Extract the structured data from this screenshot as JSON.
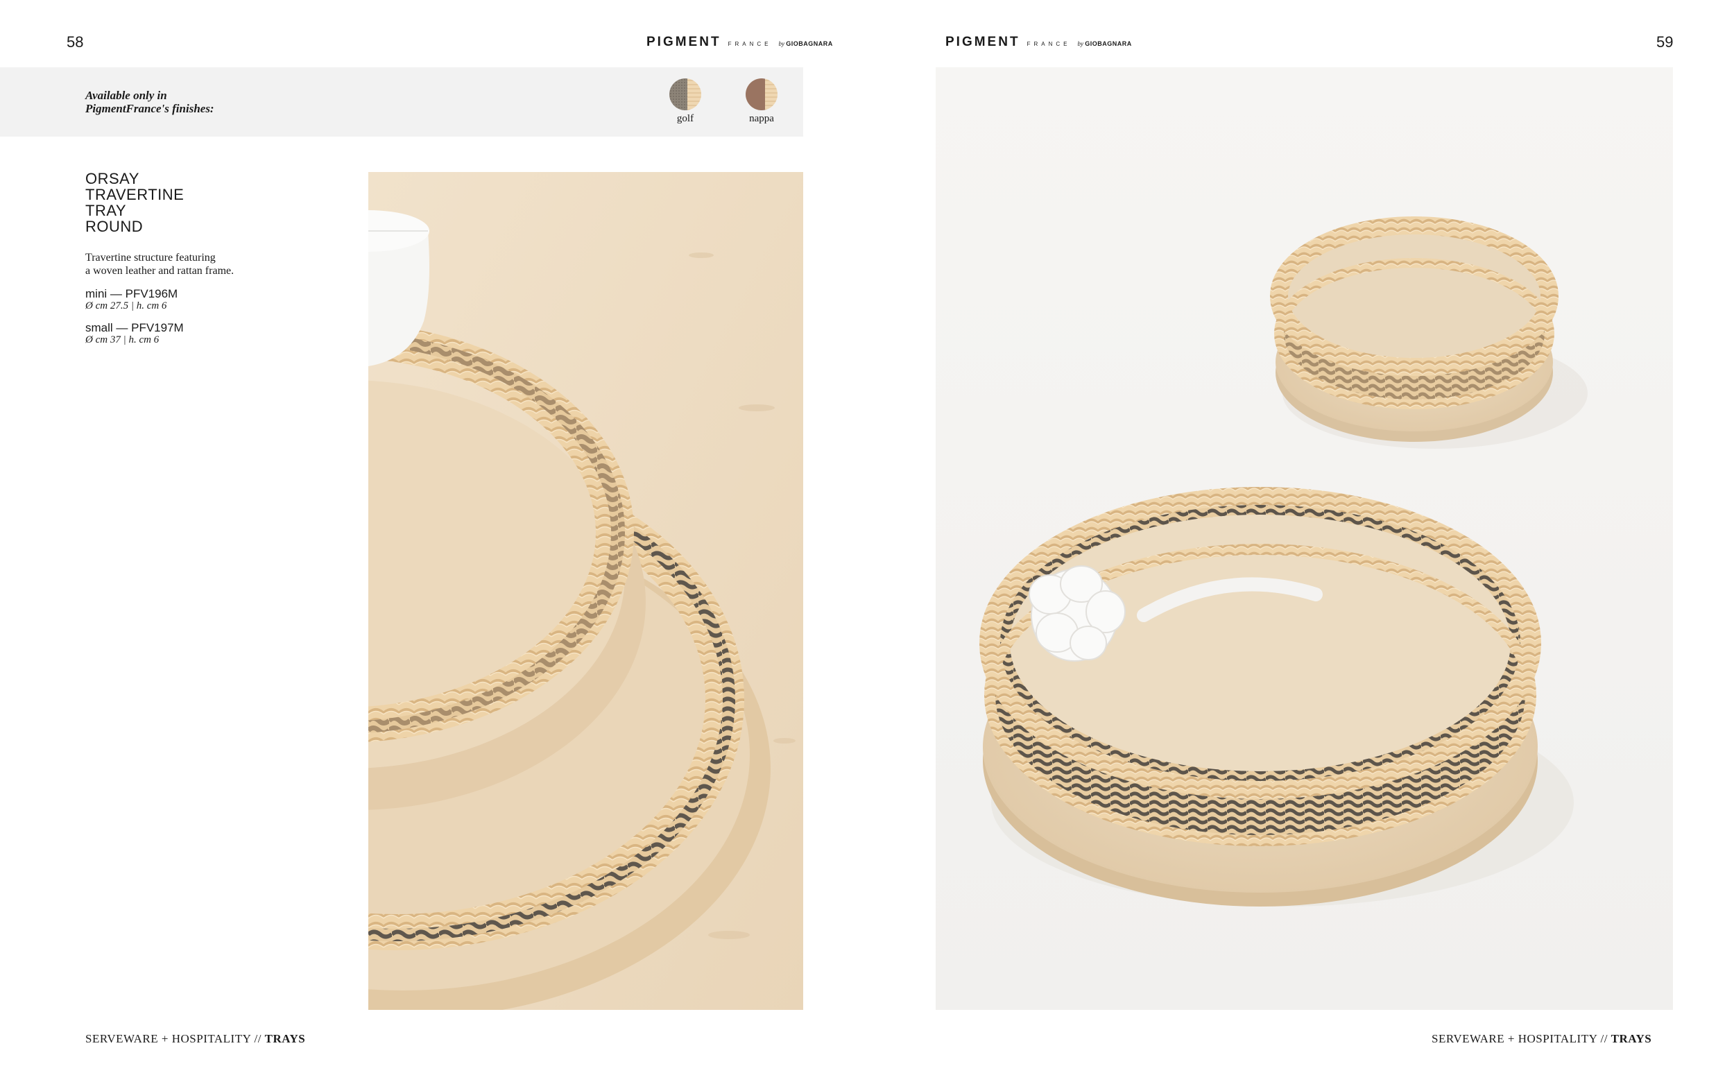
{
  "left_page": {
    "page_number": "58",
    "brand": {
      "main": "PIGMENT",
      "sub": "FRANCE",
      "by": "by",
      "maker": "GIOBAGNARA"
    },
    "finishes": {
      "label_line1": "Available only in",
      "label_line2": "PigmentFrance's finishes:",
      "items": [
        {
          "name": "golf",
          "icon": "golf-finish-swatch"
        },
        {
          "name": "nappa",
          "icon": "nappa-finish-swatch"
        }
      ]
    },
    "product": {
      "title_lines": [
        "ORSAY",
        "TRAVERTINE",
        "TRAY",
        "ROUND"
      ],
      "description_line1": "Travertine structure featuring",
      "description_line2": "a woven leather and rattan frame.",
      "variants": [
        {
          "name": "mini — PFV196M",
          "dimensions": "Ø cm 27.5 | h. cm 6"
        },
        {
          "name": "small — PFV197M",
          "dimensions": "Ø cm 37 | h. cm 6"
        }
      ]
    },
    "footer": {
      "section": "SERVEWARE + HOSPITALITY // ",
      "category": "TRAYS"
    }
  },
  "right_page": {
    "page_number": "59",
    "brand": {
      "main": "PIGMENT",
      "sub": "FRANCE",
      "by": "by",
      "maker": "GIOBAGNARA"
    },
    "footer": {
      "section": "SERVEWARE + HOSPITALITY // ",
      "category": "TRAYS"
    }
  },
  "colors": {
    "finish_bar": "#f2f2f2",
    "travertine": "#e8d5b9",
    "rattan": "#ecd2aa",
    "leather_dark": "#5e554b",
    "leather_taupe": "#a8916f"
  }
}
